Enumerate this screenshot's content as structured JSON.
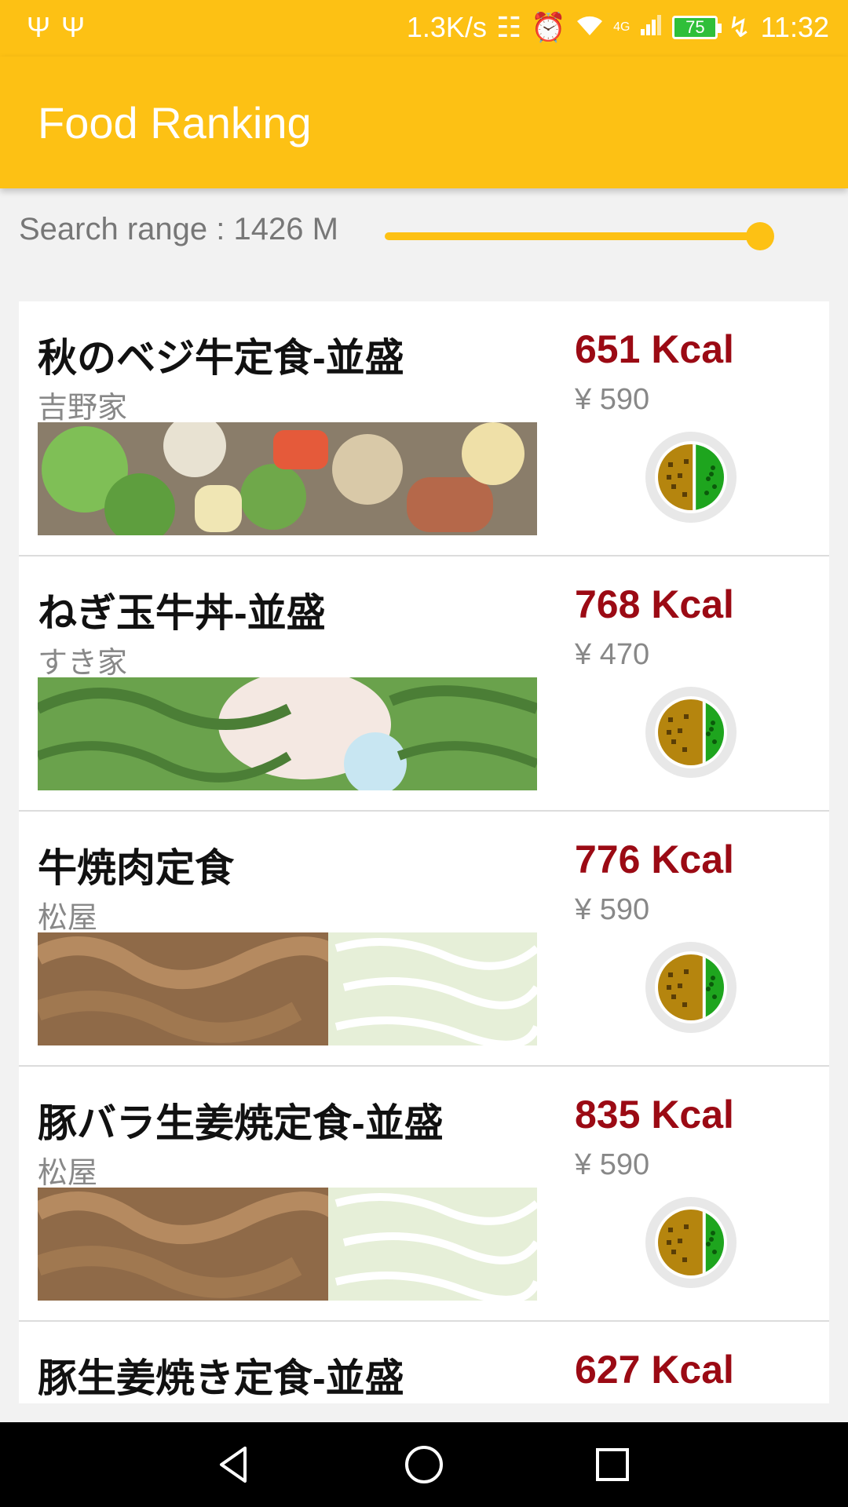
{
  "status_bar": {
    "net_speed": "1.3K/s",
    "signal_type": "4G",
    "battery": "75",
    "time": "11:32",
    "icons": [
      "usb-icon",
      "usb-icon",
      "vibrate-icon",
      "alarm-icon",
      "wifi-icon",
      "cell-signal-icon",
      "battery-icon",
      "charging-icon"
    ]
  },
  "app_bar": {
    "title": "Food Ranking"
  },
  "search": {
    "label": "Search range : 1426 M",
    "slider_fraction": 1.0
  },
  "colors": {
    "accent": "#fdc114",
    "kcal": "#9b0a14",
    "meat": "#b5850e",
    "veg": "#1ea51e"
  },
  "items": [
    {
      "name": "秋のベジ牛定食-並盛",
      "shop": "吉野家",
      "kcal": "651 Kcal",
      "price": "¥ 590",
      "photo": "vegetables",
      "veg_fraction": 0.45
    },
    {
      "name": "ねぎ玉牛丼-並盛",
      "shop": "すき家",
      "kcal": "768 Kcal",
      "price": "¥ 470",
      "photo": "negi-tama-gyudon",
      "veg_fraction": 0.3
    },
    {
      "name": "牛焼肉定食",
      "shop": "松屋",
      "kcal": "776 Kcal",
      "price": "¥ 590",
      "photo": "yakiniku-cabbage",
      "veg_fraction": 0.3
    },
    {
      "name": "豚バラ生姜焼定食-並盛",
      "shop": "松屋",
      "kcal": "835 Kcal",
      "price": "¥ 590",
      "photo": "yakiniku-cabbage",
      "veg_fraction": 0.3
    },
    {
      "name": "豚生姜焼き定食-並盛",
      "shop": "",
      "kcal": "627 Kcal",
      "price": "",
      "photo": "",
      "veg_fraction": 0.3
    }
  ]
}
